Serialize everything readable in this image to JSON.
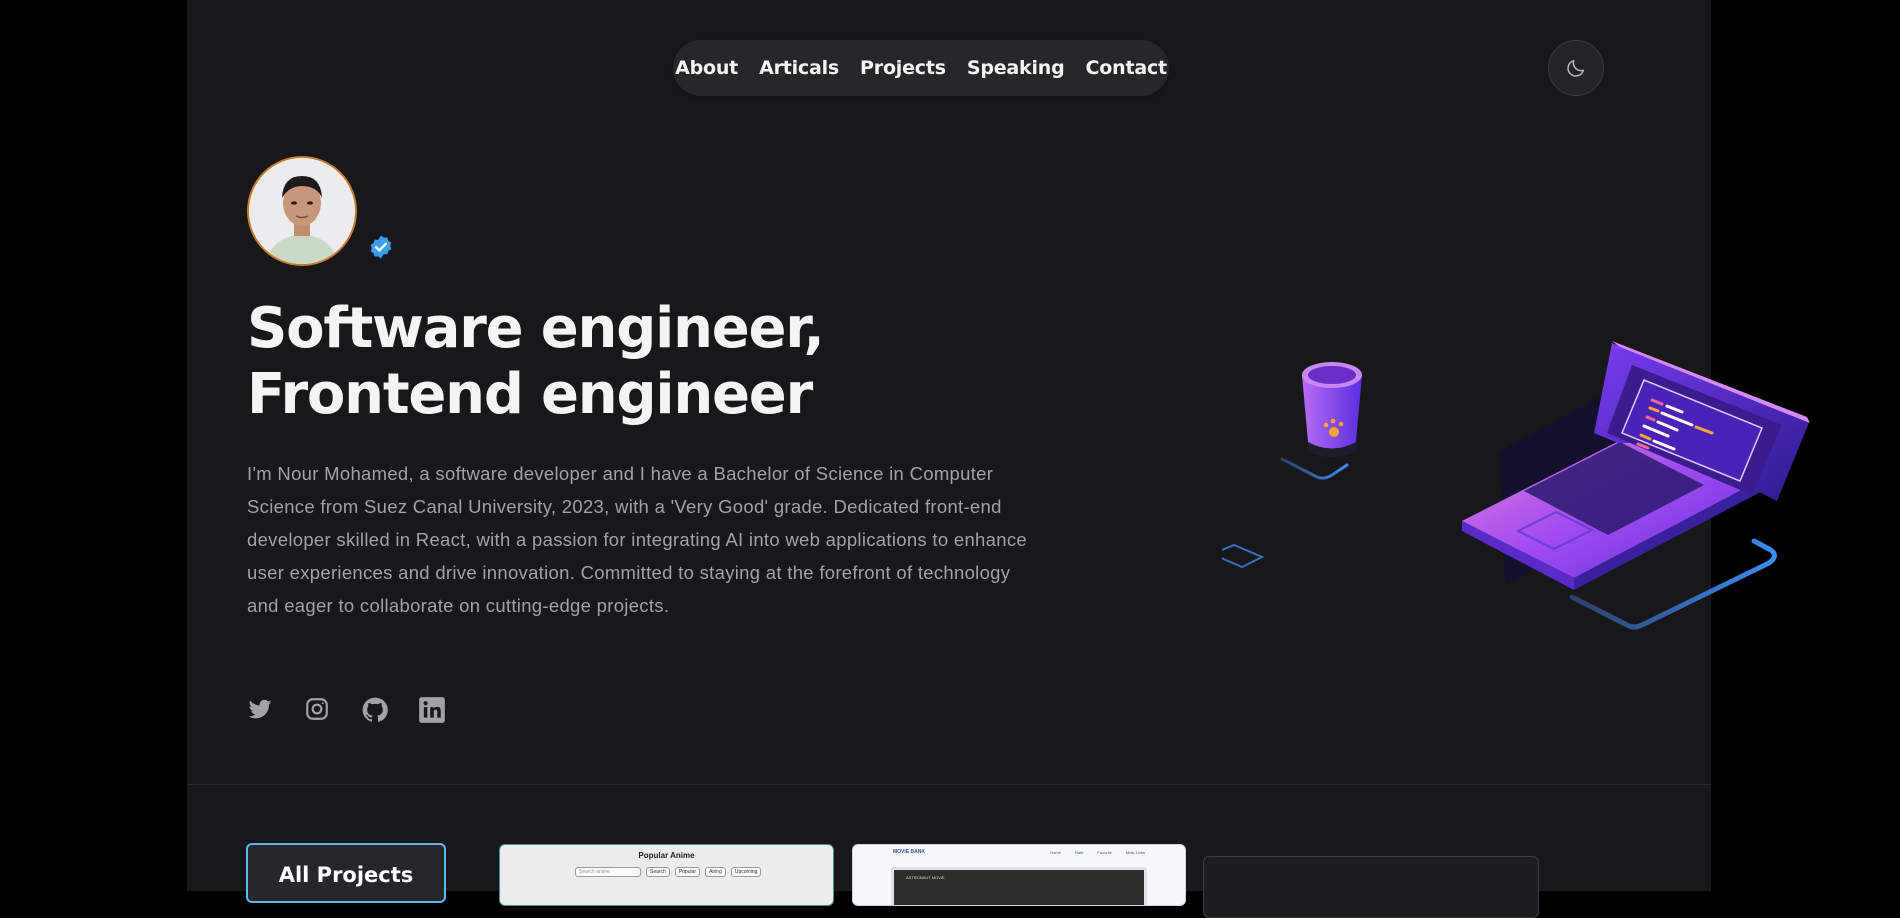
{
  "nav": {
    "items": [
      "About",
      "Articals",
      "Projects",
      "Speaking",
      "Contact"
    ]
  },
  "theme_toggle": {
    "icon": "moon-icon"
  },
  "hero": {
    "headline": "Software engineer, Frontend engineer",
    "bio": "I'm Nour Mohamed, a software developer and I have a Bachelor of Science in Computer Science from Suez Canal University, 2023, with a 'Very Good' grade. Dedicated front-end developer skilled in React, with a passion for integrating AI into web applications to enhance user experiences and drive innovation. Committed to staying at the forefront of technology and eager to collaborate on cutting-edge projects."
  },
  "social": [
    "twitter-icon",
    "instagram-icon",
    "github-icon",
    "linkedin-icon"
  ],
  "projects": {
    "all_label": "All Projects",
    "card1": {
      "title": "Popular Anime",
      "search_placeholder": "Search anime",
      "buttons": [
        "Search",
        "Popular",
        "Airing",
        "Upcoming"
      ]
    },
    "card2": {
      "logo": "MOVIE BANK",
      "links": [
        "Home",
        "Rate",
        "Favorite",
        "Most Links"
      ],
      "hero_label": "ASTRONAUT MOVIE"
    }
  },
  "colors": {
    "page_bg": "#18181b",
    "outer_bg": "#000000",
    "accent": "#5fb7f0",
    "avatar_ring": "#c87a2a",
    "verified": "#3b9ef0"
  }
}
